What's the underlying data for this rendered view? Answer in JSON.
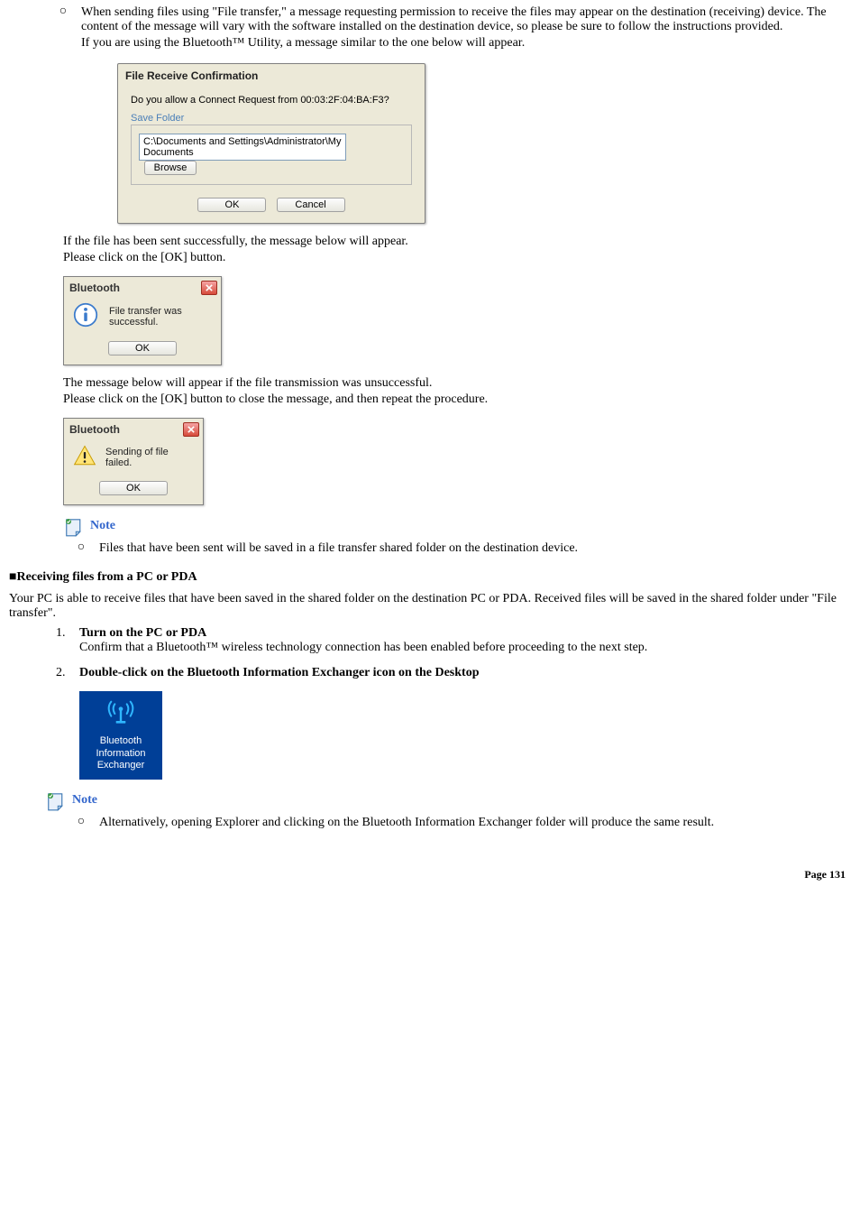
{
  "intro": {
    "bullet_mark": "○",
    "para1": "When sending files using \"File transfer,\" a message requesting permission to receive the files may appear on the destination (receiving) device. The content of the message will vary with the software installed on the destination device, so please be sure to follow the instructions provided.",
    "para2": "If you are using the Bluetooth™ Utility, a message similar to the one below will appear."
  },
  "dialog": {
    "title": "File Receive Confirmation",
    "question": "Do you allow a Connect Request from 00:03:2F:04:BA:F3?",
    "save_label": "Save Folder",
    "path_value": "C:\\Documents and Settings\\Administrator\\My Documents",
    "browse_label": "Browse",
    "ok_label": "OK",
    "cancel_label": "Cancel"
  },
  "success": {
    "para1": "If the file has been sent successfully, the message below will appear.",
    "para2": "Please click on the [OK] button.",
    "title": "Bluetooth",
    "text": "File transfer was successful.",
    "ok_label": "OK"
  },
  "fail": {
    "para1": "The message below will appear if the file transmission was unsuccessful.",
    "para2": "Please click on the [OK] button to close the message, and then repeat the procedure.",
    "title": "Bluetooth",
    "text": "Sending of file failed.",
    "ok_label": "OK"
  },
  "note1": {
    "label": "Note",
    "bullet_mark": "○",
    "text": "Files that have been sent will be saved in a file transfer shared folder on the destination device."
  },
  "section_heading": "■Receiving files from a PC or PDA",
  "section_intro": "Your PC is able to receive files that have been saved in the shared folder on the destination PC or PDA. Received files will be saved in the shared folder under \"File transfer\".",
  "steps": {
    "s1_title": "Turn on the PC or PDA",
    "s1_body": "Confirm that a Bluetooth™ wireless technology connection has been enabled before proceeding to the next step.",
    "s2_title": "Double-click on the Bluetooth Information Exchanger icon on the Desktop"
  },
  "bie_icon": {
    "line1": "Bluetooth",
    "line2": "Information",
    "line3": "Exchanger"
  },
  "note2": {
    "label": "Note",
    "bullet_mark": "○",
    "text": "Alternatively, opening Explorer and clicking on the Bluetooth Information Exchanger folder will produce the same result."
  },
  "footer": "Page 131"
}
